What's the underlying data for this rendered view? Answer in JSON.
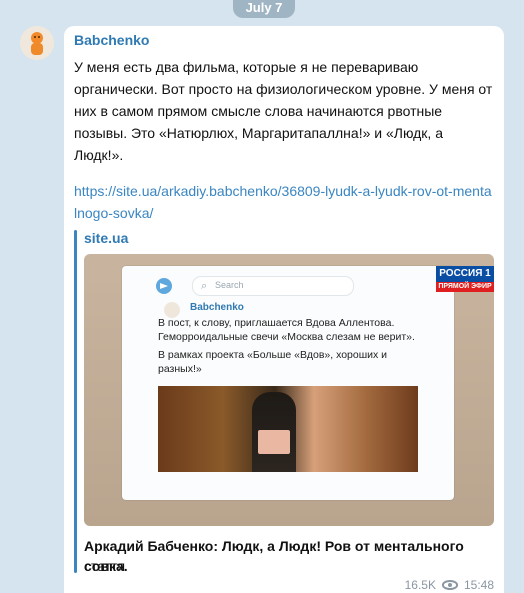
{
  "date_pill": "July 7",
  "message": {
    "author": "Babchenko",
    "text": "У меня есть два фильма, которые я не перевариваю органически. Вот просто на физиологическом уровне. У меня от них в самом прямом смысле слова начинаются рвотные позывы. Это «Натюрлюх, Маргаритапаллна!» и «Людк, а Людк!».",
    "link": "https://site.ua/arkadiy.babchenko/36809-lyudk-a-lyudk-rov-ot-mentalnogo-sovka/",
    "views": "16.5K",
    "time": "15:48"
  },
  "preview": {
    "site_name": "site.ua",
    "title": "Аркадий Бабченко: Людк, а Людк! Ров от ментального совка.",
    "subtitle": "стаття",
    "inner": {
      "search_placeholder": "Search",
      "author": "Babchenko",
      "text1": "В пост, к слову, приглашается Вдова Аллентова. Геморроидальные свечи «Москва слезам не верит».",
      "text2": "В рамках проекта «Больше «Вдов», хороших и разных!»",
      "tv_logo": "РОССИЯ 1",
      "tv_sub": "ПРЯМОЙ ЭФИР"
    }
  },
  "colors": {
    "background": "#d5e4ee",
    "accent": "#2f7ab3",
    "link": "#3a86c2"
  }
}
